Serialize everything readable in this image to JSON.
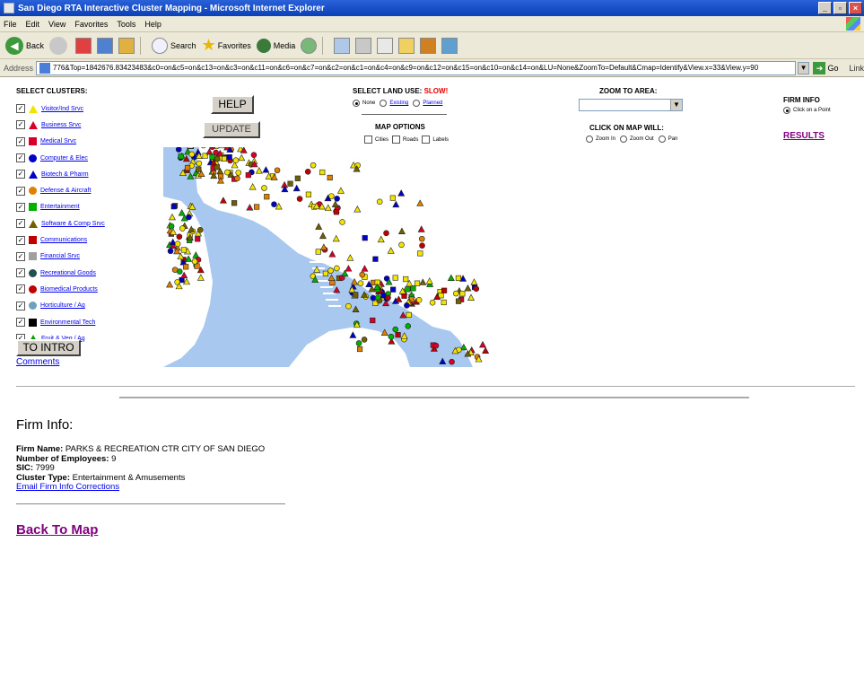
{
  "window": {
    "title": "San Diego RTA Interactive Cluster Mapping - Microsoft Internet Explorer"
  },
  "menu": [
    "File",
    "Edit",
    "View",
    "Favorites",
    "Tools",
    "Help"
  ],
  "toolbar": {
    "back": "Back",
    "search": "Search",
    "favorites": "Favorites",
    "media": "Media"
  },
  "address": {
    "label": "Address",
    "url": "776&Top=1842676.83423483&c0=on&c5=on&c13=on&c3=on&c11=on&c6=on&c7=on&c2=on&c1=on&c4=on&c9=on&c12=on&c15=on&c10=on&c14=on&LU=None&ZoomTo=Default&Cmap=Identify&View.x=33&View.y=90",
    "go": "Go",
    "links": "Link"
  },
  "clusters": {
    "title": "SELECT CLUSTERS:",
    "items": [
      {
        "label": "Visitor/Ind Srvc",
        "color": "#f2e400",
        "shape": "tri"
      },
      {
        "label": "Business Srvc",
        "color": "#d8002a",
        "shape": "tri"
      },
      {
        "label": "Medical Srvc",
        "color": "#d8002a",
        "shape": "sq"
      },
      {
        "label": "Computer & Elec",
        "color": "#0000c8",
        "shape": "circ"
      },
      {
        "label": "Biotech & Pharm",
        "color": "#0000c8",
        "shape": "tri"
      },
      {
        "label": "Defense & Aircraft",
        "color": "#e08000",
        "shape": "circ"
      },
      {
        "label": "Entertainment",
        "color": "#00b000",
        "shape": "sq"
      },
      {
        "label": "Software & Comp Srvc",
        "color": "#706000",
        "shape": "tri"
      },
      {
        "label": "Communications",
        "color": "#c00000",
        "shape": "sq"
      },
      {
        "label": "Financial Srvc",
        "color": "#a0a0a0",
        "shape": "sq"
      },
      {
        "label": "Recreational Goods",
        "color": "#205050",
        "shape": "circ"
      },
      {
        "label": "Biomedical Products",
        "color": "#c00000",
        "shape": "circ"
      },
      {
        "label": "Horticulture / Ag",
        "color": "#70a0c0",
        "shape": "circ"
      },
      {
        "label": "Environmental Tech",
        "color": "#000000",
        "shape": "sq"
      },
      {
        "label": "Fruit & Veg / Ag",
        "color": "#00a000",
        "shape": "tri"
      }
    ],
    "checked_mark": "✓"
  },
  "buttons": {
    "intro": "TO INTRO",
    "help": "HELP",
    "update": "UPDATE"
  },
  "comments_link": "Comments",
  "land_use": {
    "title": "SELECT LAND USE:",
    "slow": "SLOW!",
    "options": [
      "None",
      "Existing",
      "Planned"
    ]
  },
  "map_options": {
    "title": "MAP OPTIONS",
    "options": [
      "Cities",
      "Roads",
      "Labels"
    ]
  },
  "zoom": {
    "title": "ZOOM TO AREA:",
    "value": ""
  },
  "click_on_map": {
    "title": "CLICK ON MAP WILL:",
    "options": [
      "Zoom In",
      "Zoom Out",
      "Pan"
    ]
  },
  "firm_info_panel": {
    "title": "FIRM INFO",
    "option": "Click on a Point",
    "results": "RESULTS"
  },
  "firm": {
    "heading": "Firm Info:",
    "name_label": "Firm Name:",
    "name": "PARKS & RECREATION CTR CITY OF SAN DIEGO",
    "employees_label": "Number of Employees:",
    "employees": "9",
    "sic_label": "SIC:",
    "sic": "7999",
    "cluster_label": "Cluster Type:",
    "cluster": "Entertainment & Amusements",
    "email_link": "Email Firm Info Corrections",
    "back": "Back To Map"
  },
  "map_colors": {
    "water": "#a8c8f0",
    "land": "#ffffff"
  }
}
